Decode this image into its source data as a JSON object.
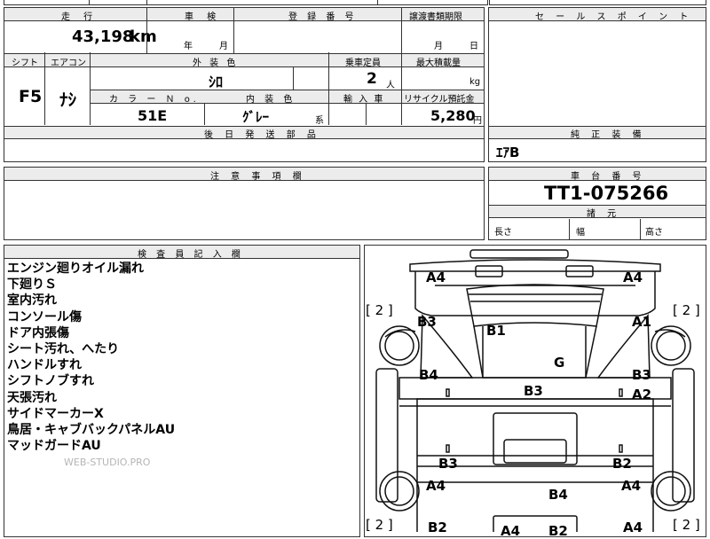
{
  "top": {
    "mileage_label": "走 行",
    "mileage_value": "43,198",
    "mileage_unit": "km",
    "inspection_label": "車 検",
    "inspection_year_unit": "年",
    "inspection_month_unit": "月",
    "registration_label": "登 録 番 号",
    "transfer_label": "譲渡書類期限",
    "transfer_month_unit": "月",
    "transfer_day_unit": "日"
  },
  "spec": {
    "shift_label": "シフト",
    "shift_value": "F5",
    "aircon_label": "エアコン",
    "aircon_value": "ﾅｼ",
    "ext_color_label": "外 装 色",
    "ext_color_value": "ｼﾛ",
    "capacity_label": "乗車定員",
    "capacity_value": "2",
    "capacity_unit": "人",
    "loadcap_label": "最大積載量",
    "loadcap_unit": "kg",
    "colorno_label": "カ ラ ー Ｎ o.",
    "colorno_value": "51E",
    "int_color_label": "内 装 色",
    "int_color_value": "ｸﾞﾚｰ",
    "int_color_suffix": "系",
    "import_label": "輸 入 車",
    "recycle_label": "リサイクル預託金",
    "recycle_value": "5,280",
    "recycle_unit": "円",
    "later_parts_label": "後 日 発 送 部 品"
  },
  "sales_point_label": "セ ー ル ス ポ イ ン ト",
  "equipment_label": "純 正 装 備",
  "equipment_value": "ｴｱB",
  "notes_label": "注 意 事 項 欄",
  "chassis_label": "車 台 番 号",
  "chassis_value": "TT1-075266",
  "dims_label": "諸 元",
  "dims": {
    "length": "長さ",
    "width": "幅",
    "height": "高さ"
  },
  "inspector_label": "検 査 員 記 入 欄",
  "remarks": [
    "エンジン廻りオイル漏れ",
    "下廻りＳ",
    "室内汚れ",
    "コンソール傷",
    "ドア内張傷",
    "シート汚れ、へたり",
    "ハンドルすれ",
    "シフトノブすれ",
    "天張汚れ",
    "サイドマーカーX",
    "鳥居・キャブバックパネルAU",
    "マッドガードAU"
  ],
  "watermark": "WEB-STUDIO.PRO",
  "diagram": {
    "brackets": [
      "[ 2 ]",
      "[ 2 ]",
      "[ 2 ]",
      "[ 2 ]"
    ],
    "marks": {
      "a4_tl": "A4",
      "a4_tr": "A4",
      "b3_l1": "B3",
      "b1": "B1",
      "a1": "A1",
      "g": "G",
      "b4_l": "B4",
      "b3_r": "B3",
      "b3_c": "B3",
      "a2": "A2",
      "b3_bl": "B3",
      "b2_br": "B2",
      "a4_bl": "A4",
      "b4_c": "B4",
      "a4_br": "A4",
      "b2_l": "B2",
      "a4_b": "A4",
      "b2_c": "B2",
      "a4_br2": "A4"
    }
  }
}
